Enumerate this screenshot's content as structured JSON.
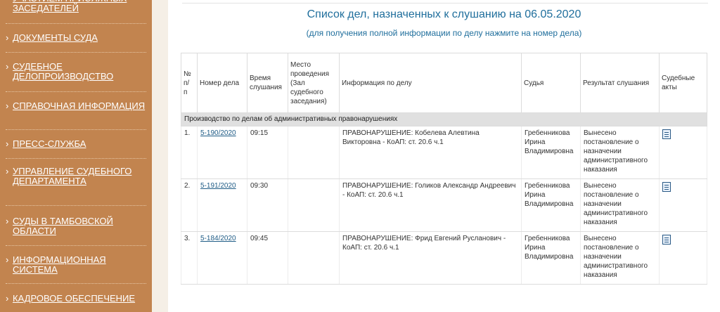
{
  "sidebar": {
    "chevron": "›",
    "items": [
      {
        "label": "УЧАСТИЕМ ПРИСЯЖНЫХ ЗАСЕДАТЕЛЕЙ"
      },
      {
        "label": "ДОКУМЕНТЫ СУДА"
      },
      {
        "label": "СУДЕБНОЕ ДЕЛОПРОИЗВОДСТВО"
      },
      {
        "label": "СПРАВОЧНАЯ ИНФОРМАЦИЯ"
      },
      {
        "label": "ПРЕСС-СЛУЖБА"
      },
      {
        "label": "УПРАВЛЕНИЕ СУДЕБНОГО ДЕПАРТАМЕНТА"
      },
      {
        "label": "СУДЫ В ТАМБОВСКОЙ ОБЛАСТИ"
      },
      {
        "label": "ИНФОРМАЦИОННАЯ СИСТЕМА"
      },
      {
        "label": "КАДРОВОЕ ОБЕСПЕЧЕНИЕ"
      }
    ]
  },
  "main": {
    "title": "Список дел, назначенных к слушанию на 06.05.2020",
    "subtitle": "(для получения полной информации по делу нажмите на номер дела)",
    "table": {
      "headers": [
        "№ п/ п",
        "Номер дела",
        "Время слушания",
        "Место проведения (Зал судебного заседания)",
        "Информация по делу",
        "Судья",
        "Результат слушания",
        "Судебные акты"
      ],
      "section": "Производство по делам об административных правонарушениях",
      "rows": [
        {
          "num": "1.",
          "case": "5-190/2020",
          "time": "09:15",
          "place": "",
          "info": "ПРАВОНАРУШЕНИЕ: Кобелева Алевтина Викторовна - КоАП: ст. 20.6 ч.1",
          "judge": "Гребенникова Ирина Владимировна",
          "result": "Вынесено постановление о назначении административного наказания",
          "act_icon": "document-icon"
        },
        {
          "num": "2.",
          "case": "5-191/2020",
          "time": "09:30",
          "place": "",
          "info": "ПРАВОНАРУШЕНИЕ: Голиков Александр Андреевич - КоАП: ст. 20.6 ч.1",
          "judge": "Гребенникова Ирина Владимировна",
          "result": "Вынесено постановление о назначении административного наказания",
          "act_icon": "document-icon"
        },
        {
          "num": "3.",
          "case": "5-184/2020",
          "time": "09:45",
          "place": "",
          "info": "ПРАВОНАРУШЕНИЕ: Фрид Евгений Русланович - КоАП: ст. 20.6 ч.1",
          "judge": "Гребенникова Ирина Владимировна",
          "result": "Вынесено постановление о назначении административного наказания",
          "act_icon": "document-icon"
        }
      ]
    }
  },
  "colors": {
    "sidebar": "#c2844f",
    "page_background": "#f5efe6",
    "title": "#1f6e9c",
    "link": "#1f5c86",
    "section_row": "#e0e0e0"
  }
}
